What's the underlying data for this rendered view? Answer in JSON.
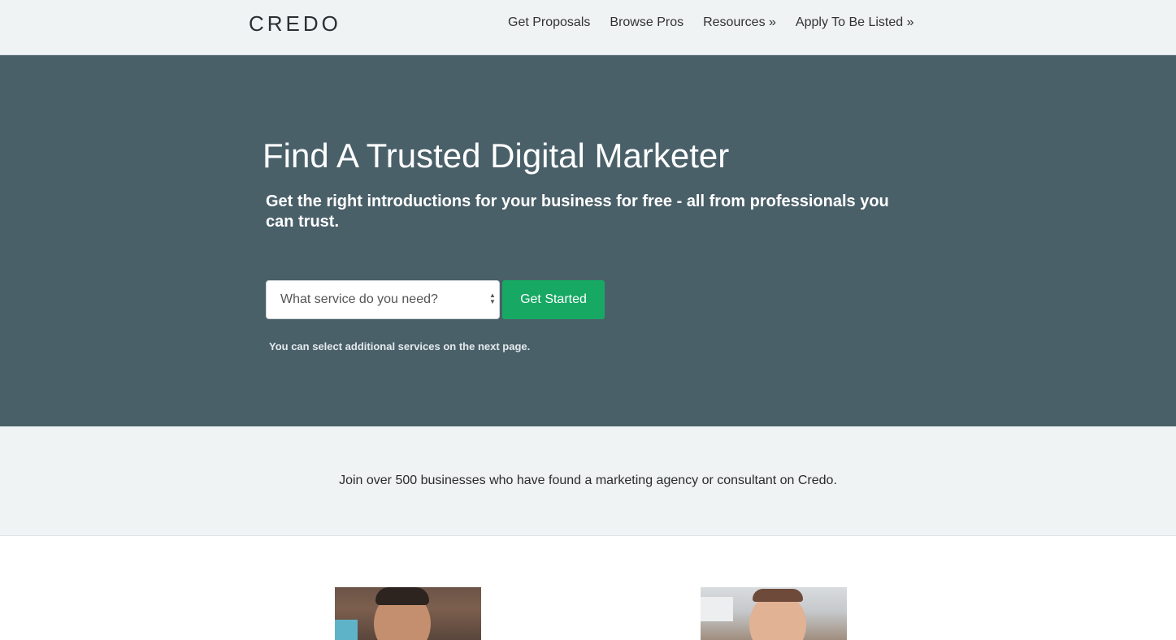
{
  "header": {
    "logo": "CREDO",
    "nav": [
      {
        "label": "Get Proposals"
      },
      {
        "label": "Browse Pros"
      },
      {
        "label": "Resources »"
      },
      {
        "label": "Apply To Be Listed »"
      }
    ]
  },
  "hero": {
    "title": "Find A Trusted Digital Marketer",
    "subtitle": "Get the right introductions for your business for free - all from professionals you can trust.",
    "select_placeholder": "What service do you need?",
    "cta_label": "Get Started",
    "hint": "You can select additional services on the next page."
  },
  "band": {
    "text": "Join over 500 businesses who have found a marketing agency or consultant on Credo."
  },
  "colors": {
    "hero_bg": "#4a6069",
    "cta_bg": "#17a864",
    "band_bg": "#eff3f4"
  }
}
